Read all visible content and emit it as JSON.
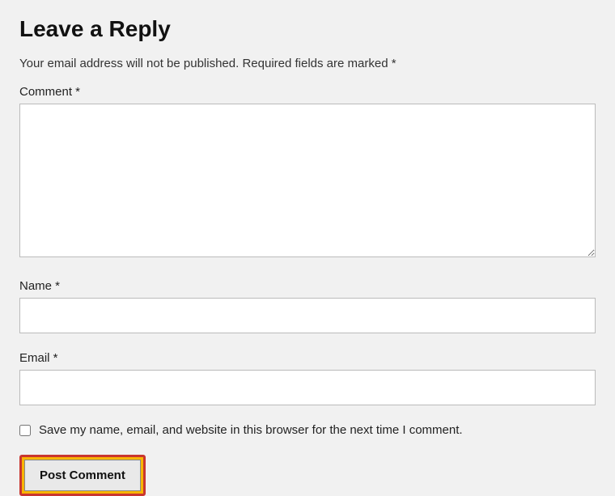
{
  "heading": "Leave a Reply",
  "notice_prefix": "Your email address will not be published.",
  "notice_required": "Required fields are marked *",
  "fields": {
    "comment_label": "Comment *",
    "name_label": "Name *",
    "email_label": "Email *"
  },
  "checkbox_label": "Save my name, email, and website in this browser for the next time I comment.",
  "submit_label": "Post Comment"
}
